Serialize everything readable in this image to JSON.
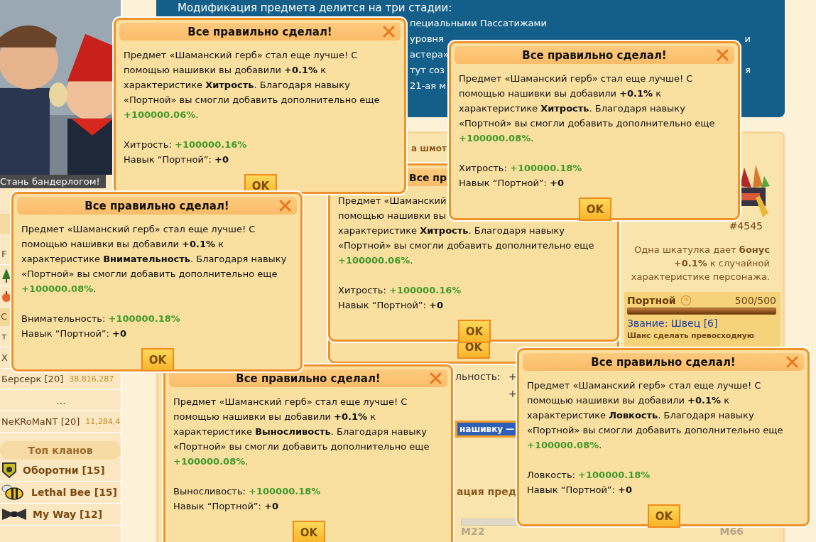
{
  "sidebar": {
    "banner_caption": "Стань бандерлогом!",
    "rows": [
      {
        "kind": "text",
        "name": "F"
      },
      {
        "kind": "tree"
      },
      {
        "kind": "fruit"
      },
      {
        "kind": "header",
        "name": "С"
      },
      {
        "kind": "text",
        "name": "т"
      },
      {
        "kind": "text",
        "name": "Х"
      },
      {
        "kind": "player",
        "name": "Берсерк [20]",
        "score": "38,816,287"
      },
      {
        "kind": "ellipsis",
        "name": "..."
      },
      {
        "kind": "player",
        "name": "NeKRoMaNT [20]",
        "score": "11,284,4"
      }
    ],
    "clans_title": "Топ кланов",
    "clans": [
      {
        "kind": "shield",
        "name": "Оборотни [15]"
      },
      {
        "kind": "bee",
        "name": "Lethal Bee [15]"
      },
      {
        "kind": "bowtie",
        "name": "My Way [12]"
      }
    ]
  },
  "info_box": {
    "title": "Модификация предмета делится на три стадии:",
    "lines": [
      {
        "text": "пециальными Пассатижами"
      },
      {
        "text": "уровня",
        "tail": "и"
      },
      {
        "text": "астера»"
      },
      {
        "text": "тут соз",
        "tail": "я"
      },
      {
        "text": "21-ая м"
      }
    ]
  },
  "craft_panel": {
    "title": "а шмот",
    "stat_label": "льность:",
    "stat_marks": [
      "+",
      "+"
    ],
    "action_button": "нашивку —",
    "section_title": "ация пред",
    "slider_labels": [
      "M22",
      "M66"
    ]
  },
  "box_card": {
    "number": "#4545",
    "description": "Одна шкатулка дает **бонус +0.1%** к случайной характеристике персонажа.",
    "skill": {
      "name": "Портной",
      "value": "500/500",
      "level": 1,
      "rank": "Звание: Швец [6]",
      "chance": "Шанс сделать превосходную"
    }
  },
  "dialogs": [
    {
      "kind": "full",
      "title": "Все правильно сделал!",
      "message": "Предмет «Шаманский герб» стал еще лучше! С помощью нашивки вы добавили **+0.1%** к характеристике **Хитрость**. Благодаря навыку «Портной» вы смогли добавить дополнительно еще",
      "bonus": "+100000.06%",
      "message_end": ".",
      "stat_label": "Хитрость:",
      "stat_value": "+100000.16%",
      "skill_label": "Навык “Портной”:",
      "skill_value": "+0",
      "ok": "OK"
    },
    {
      "kind": "full",
      "title": "Все правильно сделал!",
      "message": "Предмет «Шаманский герб» стал еще лучше! С помощью нашивки вы добавили **+0.1%** к характеристике **Хитрость**. Благодаря навыку «Портной» вы смогли добавить дополнительно еще",
      "bonus": "+100000.08%",
      "message_end": ".",
      "stat_label": "Хитрость:",
      "stat_value": "+100000.18%",
      "skill_label": "Навык “Портной”:",
      "skill_value": "+0",
      "ok": "OK"
    },
    {
      "kind": "partial",
      "title": "Все пр",
      "lines": [
        "Предмет «Шаманский",
        "помощью нашивки вы",
        "характеристике **Хитрость**. Благодаря навыку",
        "«Портной» вы смогли добавить дополнительно еще"
      ],
      "bonus": "+100000.06%",
      "message_end": ".",
      "stat_label": "Хитрость:",
      "stat_value": "+100000.16%",
      "skill_label": "Навык “Портной”:",
      "skill_value": "+0",
      "ok": "OK"
    },
    {
      "kind": "ok_only",
      "ok": "OK"
    },
    {
      "kind": "full",
      "title": "Все правильно сделал!",
      "message": "Предмет «Шаманский герб» стал еще лучше! С помощью нашивки вы добавили **+0.1%** к характеристике **Внимательность**. Благодаря навыку «Портной» вы смогли добавить дополнительно еще",
      "bonus": "+100000.08%",
      "message_end": ".",
      "stat_label": "Внимательность:",
      "stat_value": "+100000.18%",
      "skill_label": "Навык “Портной”:",
      "skill_value": "+0",
      "ok": "OK"
    },
    {
      "kind": "full",
      "title": "Все правильно сделал!",
      "message": "Предмет «Шаманский герб» стал еще лучше! С помощью нашивки вы добавили **+0.1%** к характеристике **Выносливость**. Благодаря навыку «Портной» вы смогли добавить дополнительно еще",
      "bonus": "+100000.08%",
      "message_end": ".",
      "stat_label": "Выносливость:",
      "stat_value": "+100000.18%",
      "skill_label": "Навык “Портной”:",
      "skill_value": "+0",
      "ok": "OK"
    },
    {
      "kind": "full",
      "title": "Все правильно сделал!",
      "message": "Предмет «Шаманский герб» стал еще лучше! С помощью нашивки вы добавили **+0.1%** к характеристике **Ловкость**. Благодаря навыку «Портной» вы смогли добавить дополнительно еще",
      "bonus": "+100000.08%",
      "message_end": ".",
      "stat_label": "Ловкость:",
      "stat_value": "+100000.18%",
      "skill_label": "Навык “Портной”:",
      "skill_value": "+0",
      "ok": "OK"
    }
  ]
}
